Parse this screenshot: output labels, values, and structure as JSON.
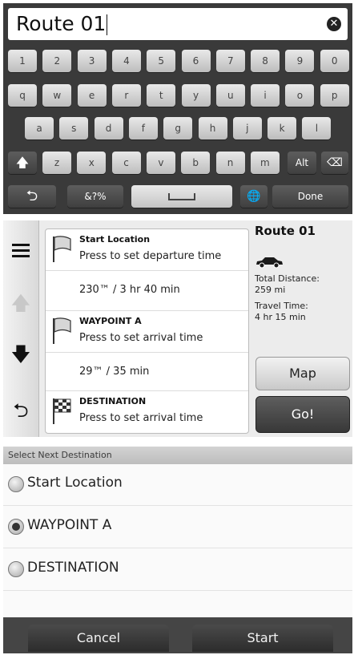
{
  "search": {
    "value": "Route 01",
    "clear_icon": "close-icon"
  },
  "keyboard": {
    "row1": [
      "1",
      "2",
      "3",
      "4",
      "5",
      "6",
      "7",
      "8",
      "9",
      "0"
    ],
    "row2": [
      "q",
      "w",
      "e",
      "r",
      "t",
      "y",
      "u",
      "i",
      "o",
      "p"
    ],
    "row3": [
      "a",
      "s",
      "d",
      "f",
      "g",
      "h",
      "j",
      "k",
      "l"
    ],
    "row4": [
      "z",
      "x",
      "c",
      "v",
      "b",
      "n",
      "m"
    ],
    "shift_icon": "shift-arrow-icon",
    "alt_label": "Alt",
    "backspace_icon": "backspace-icon",
    "back_icon": "back-arrow-icon",
    "symbols_label": "&?%",
    "space_icon": "space-icon",
    "globe_icon": "globe-icon",
    "done_label": "Done"
  },
  "route": {
    "name": "Route 01",
    "total_distance_label": "Total Distance:",
    "total_distance_value": "259 mi",
    "travel_time_label": "Travel Time:",
    "travel_time_value": "4 hr 15 min",
    "rows": [
      {
        "title": "Start Location",
        "subtitle": "Press to set departure time"
      },
      {
        "leg": "230™ / 3 hr 40 min"
      },
      {
        "title": "WAYPOINT A",
        "subtitle": "Press to set arrival time"
      },
      {
        "leg": "29™ / 35 min"
      },
      {
        "title": "DESTINATION",
        "subtitle": "Press to set arrival time"
      }
    ],
    "map_label": "Map",
    "go_label": "Go!",
    "icons": [
      "menu-icon",
      "up-arrow-icon",
      "down-arrow-icon",
      "back-arrow-icon",
      "flag-icon",
      "checkered-flag-icon",
      "car-icon"
    ]
  },
  "select_next": {
    "header": "Select Next Destination",
    "options": [
      {
        "label": "Start Location",
        "selected": false
      },
      {
        "label": "WAYPOINT A",
        "selected": true
      },
      {
        "label": "DESTINATION",
        "selected": false
      }
    ],
    "cancel_label": "Cancel",
    "start_label": "Start"
  }
}
